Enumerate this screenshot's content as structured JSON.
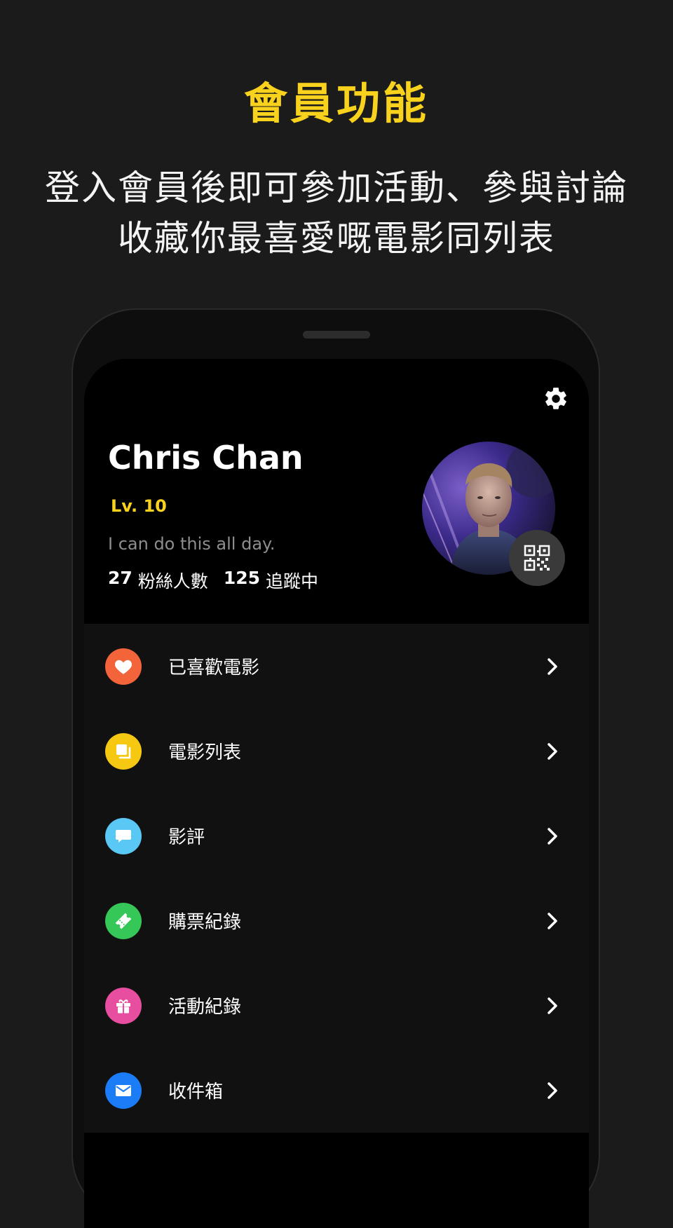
{
  "promo": {
    "title": "會員功能",
    "subtitle_line1": "登入會員後即可參加活動、參與討論",
    "subtitle_line2": "收藏你最喜愛嘅電影同列表"
  },
  "profile": {
    "name": "Chris Chan",
    "level": "Lv. 10",
    "bio": "I can do this all day.",
    "followers_count": "27",
    "followers_label": "粉絲人數",
    "following_count": "125",
    "following_label": "追蹤中",
    "settings_icon": "gear-icon",
    "qr_icon": "qr-code-icon"
  },
  "menu": {
    "items": [
      {
        "label": "已喜歡電影",
        "icon": "heart-icon",
        "color": "#f3643a"
      },
      {
        "label": "電影列表",
        "icon": "stack-icon",
        "color": "#f6c812"
      },
      {
        "label": "影評",
        "icon": "chat-bubble-icon",
        "color": "#5ac8f5"
      },
      {
        "label": "購票紀錄",
        "icon": "ticket-icon",
        "color": "#36c759"
      },
      {
        "label": "活動紀錄",
        "icon": "gift-icon",
        "color": "#e84ea0"
      },
      {
        "label": "收件箱",
        "icon": "mail-icon",
        "color": "#1a7cf6"
      }
    ]
  },
  "colors": {
    "accent": "#f8d21c",
    "background": "#1b1b1b"
  }
}
